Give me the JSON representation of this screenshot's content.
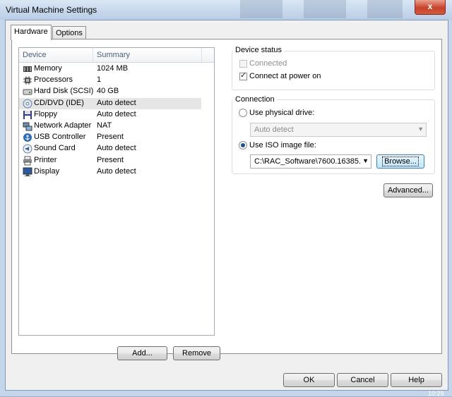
{
  "window": {
    "title": "Virtual Machine Settings",
    "close_glyph": "x"
  },
  "tabs": [
    {
      "label": "Hardware"
    },
    {
      "label": "Options"
    }
  ],
  "device_list": {
    "columns": [
      "Device",
      "Summary"
    ],
    "rows": [
      {
        "device": "Memory",
        "summary": "1024 MB",
        "icon": "memory-icon"
      },
      {
        "device": "Processors",
        "summary": "1",
        "icon": "processor-icon"
      },
      {
        "device": "Hard Disk (SCSI)",
        "summary": "40 GB",
        "icon": "hard-disk-icon"
      },
      {
        "device": "CD/DVD (IDE)",
        "summary": "Auto detect",
        "icon": "cd-dvd-icon",
        "selected": true
      },
      {
        "device": "Floppy",
        "summary": "Auto detect",
        "icon": "floppy-icon"
      },
      {
        "device": "Network Adapter",
        "summary": "NAT",
        "icon": "network-adapter-icon"
      },
      {
        "device": "USB Controller",
        "summary": "Present",
        "icon": "usb-icon"
      },
      {
        "device": "Sound Card",
        "summary": "Auto detect",
        "icon": "sound-card-icon"
      },
      {
        "device": "Printer",
        "summary": "Present",
        "icon": "printer-icon"
      },
      {
        "device": "Display",
        "summary": "Auto detect",
        "icon": "display-icon"
      }
    ]
  },
  "list_buttons": {
    "add": "Add...",
    "remove": "Remove"
  },
  "device_status": {
    "title": "Device status",
    "connected_label": "Connected",
    "connected_checked": false,
    "connect_at_power_on_label": "Connect at power on",
    "connect_at_power_on_checked": true
  },
  "connection": {
    "title": "Connection",
    "physical_drive_label": "Use physical drive:",
    "physical_drive_value": "Auto detect",
    "iso_label": "Use ISO image file:",
    "iso_value": "C:\\RAC_Software\\7600.16385.",
    "selected": "iso",
    "browse_label": "Browse..."
  },
  "advanced_label": "Advanced...",
  "footer": {
    "ok": "OK",
    "cancel": "Cancel",
    "help": "Help"
  },
  "clock": "10:29"
}
